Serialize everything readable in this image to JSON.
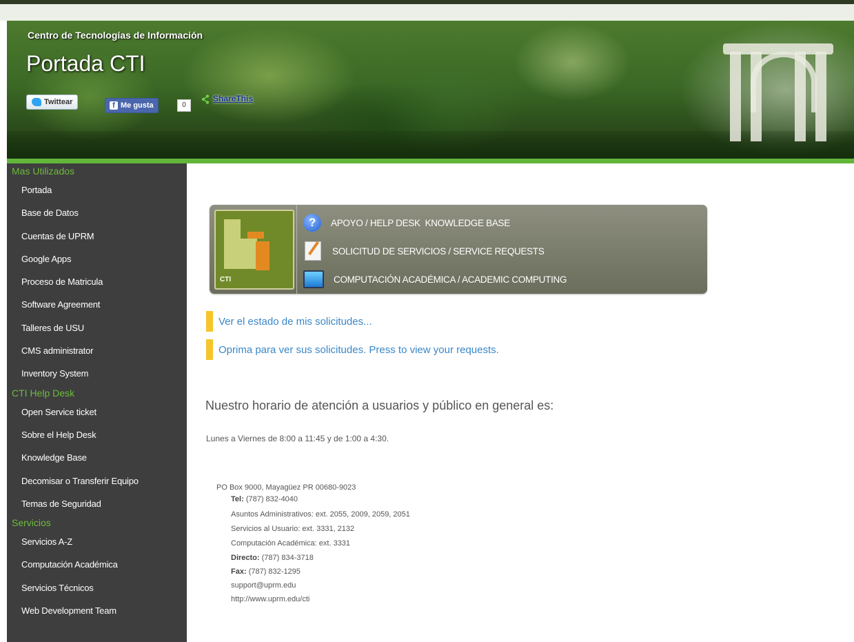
{
  "header": {
    "site_subtitle": "Centro de Tecnologías de Información",
    "site_title": "Portada CTI",
    "twitter_label": "Twittear",
    "like_label": "Me gusta",
    "like_count": "0",
    "share_label": "ShareThis"
  },
  "sidebar": {
    "sections": [
      {
        "heading": "Mas Utilizados",
        "items": [
          "Portada",
          "Base de Datos",
          "Cuentas de UPRM",
          "Google Apps",
          "Proceso de Matricula",
          "Software Agreement",
          "Talleres de USU",
          "CMS administrator",
          "Inventory System"
        ]
      },
      {
        "heading": "CTI Help Desk",
        "items": [
          "Open Service ticket",
          "Sobre el Help Desk",
          "Knowledge Base",
          "Decomisar o Transferir Equipo",
          "Temas de Seguridad"
        ]
      },
      {
        "heading": "Servicios",
        "items": [
          "Servicios A-Z",
          "Computación Académica",
          "Servicios Técnicos",
          "Web Development Team"
        ]
      }
    ]
  },
  "main": {
    "logo_text": "CTI",
    "menu": [
      {
        "label": "APOYO / HELP DESK  KNOWLEDGE BASE",
        "icon": "help-question-icon"
      },
      {
        "label": "SOLICITUD DE SERVICIOS / SERVICE REQUESTS",
        "icon": "service-request-icon"
      },
      {
        "label": "COMPUTACIÓN ACADÉMICA / ACADEMIC COMPUTING",
        "icon": "computer-monitor-icon"
      }
    ],
    "links": [
      "Ver el estado de mis solicitudes...",
      "Oprima para ver sus solicitudes. Press to view your requests."
    ],
    "hours_title": "Nuestro horario de atención a usuarios y público en general es:",
    "hours_text": "Lunes a Viernes de 8:00 a 11:45 y de 1:00 a 4:30.",
    "address": {
      "po_box": "PO Box 9000, Mayagüez PR 00680-9023",
      "tel_label": "Tel:",
      "tel_value": "(787) 832-4040",
      "admin": "Asuntos Administrativos: ext. 2055, 2009, 2059, 2051",
      "user_services": "Servicios al Usuario: ext. 3331, 2132",
      "academic": "Computación Académica: ext. 3331",
      "direct_label": "Directo:",
      "direct_value": "(787) 834-3718",
      "fax_label": "Fax:",
      "fax_value": "(787) 832-1295",
      "email": "support@uprm.edu",
      "url": "http://www.uprm.edu/cti"
    }
  },
  "colors": {
    "sidebar_bg": "#3e3e3e",
    "sidebar_heading": "#6dbb3b",
    "accent_green": "#62b73a",
    "link_blue": "#3a87c8",
    "link_marker": "#f5c52a"
  }
}
